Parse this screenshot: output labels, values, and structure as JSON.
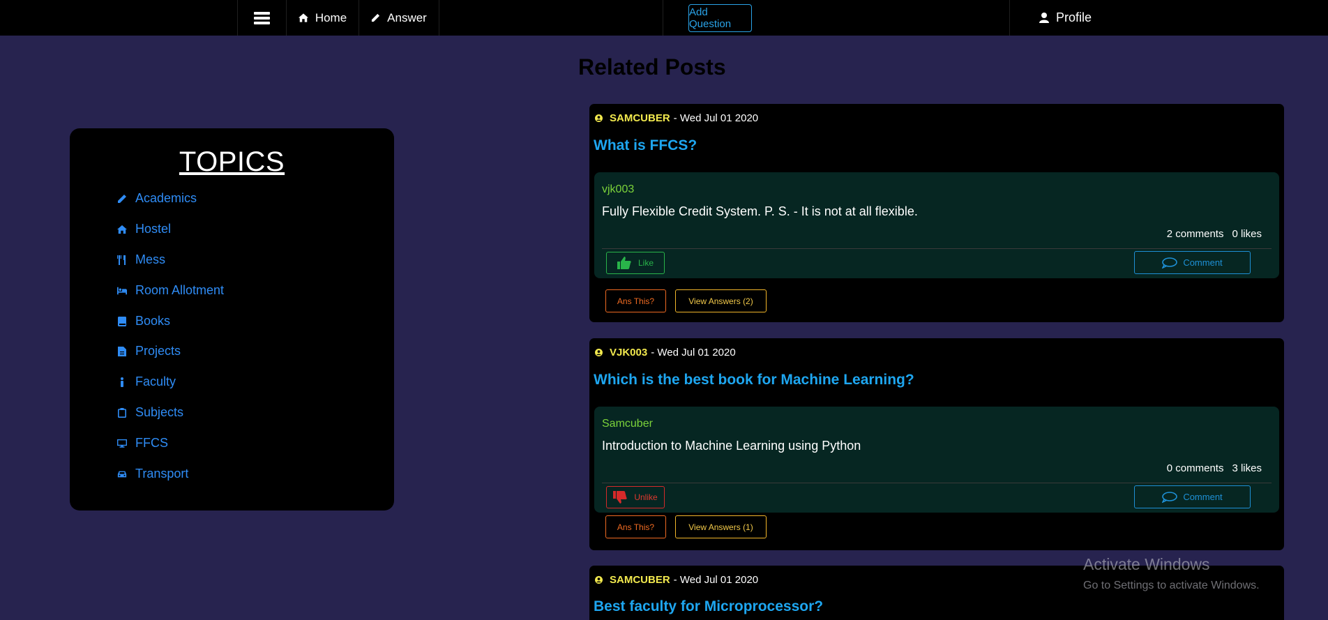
{
  "nav": {
    "home_label": "Home",
    "answer_label": "Answer",
    "add_question_label": "Add Question",
    "profile_label": "Profile"
  },
  "topics": {
    "title": "TOPICS",
    "items": [
      {
        "label": "Academics",
        "icon": "pencil-icon"
      },
      {
        "label": "Hostel",
        "icon": "home-icon"
      },
      {
        "label": "Mess",
        "icon": "utensils-icon"
      },
      {
        "label": "Room Allotment",
        "icon": "bed-icon"
      },
      {
        "label": "Books",
        "icon": "book-icon"
      },
      {
        "label": "Projects",
        "icon": "file-icon"
      },
      {
        "label": "Faculty",
        "icon": "person-icon"
      },
      {
        "label": "Subjects",
        "icon": "clipboard-icon"
      },
      {
        "label": "FFCS",
        "icon": "desktop-icon"
      },
      {
        "label": "Transport",
        "icon": "car-icon"
      }
    ]
  },
  "section_title": "Related Posts",
  "posts": [
    {
      "author": "SAMCUBER",
      "date": "- Wed Jul 01 2020",
      "question": "What is FFCS?",
      "answer": {
        "user": "vjk003",
        "text": "Fully Flexible Credit System. P. S. - It is not at all flexible.",
        "comments": "2 comments",
        "likes": "0 likes",
        "like_label": "Like",
        "comment_label": "Comment"
      },
      "ans_this_label": "Ans This?",
      "view_answers_label": "View Answers (2)"
    },
    {
      "author": "VJK003",
      "date": "- Wed Jul 01 2020",
      "question": "Which is the best book for Machine Learning?",
      "answer": {
        "user": "Samcuber",
        "text": "Introduction to Machine Learning using Python",
        "comments": "0 comments",
        "likes": "3 likes",
        "like_label": "Unlike",
        "comment_label": "Comment"
      },
      "ans_this_label": "Ans This?",
      "view_answers_label": "View Answers (1)"
    },
    {
      "author": "SAMCUBER",
      "date": "- Wed Jul 01 2020",
      "question": "Best faculty for Microprocessor?"
    }
  ],
  "watermark": {
    "title": "Activate Windows",
    "subtitle": "Go to Settings to activate Windows."
  },
  "colors": {
    "background": "#27234f",
    "accent_blue": "#1ea6f0",
    "author_yellow": "#f2e94e",
    "like_green": "#29b44a",
    "unlike_red": "#d62a2a"
  }
}
